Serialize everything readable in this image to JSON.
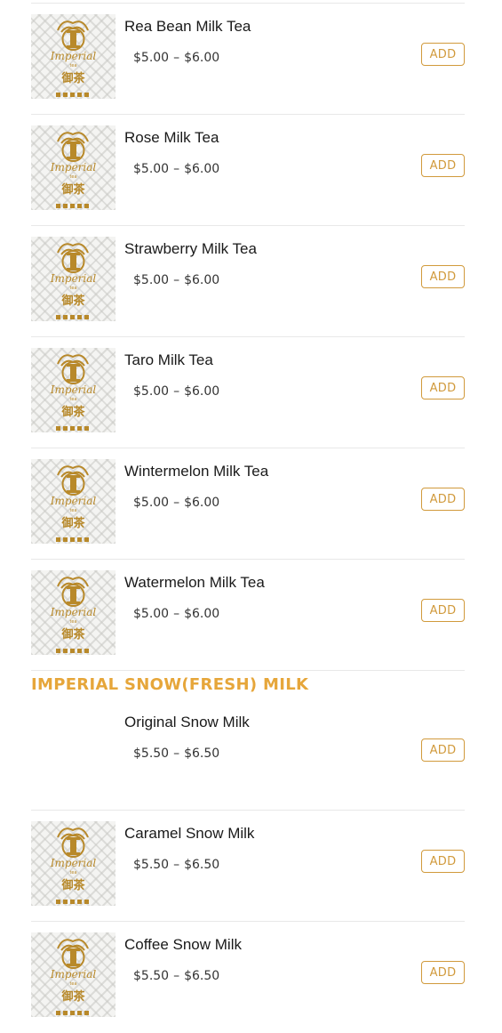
{
  "logo_text": {
    "brand": "Imperial",
    "sub": "tea",
    "cn": "御茶"
  },
  "button_label": "ADD",
  "section": {
    "title": "IMPERIAL SNOW(FRESH) MILK"
  },
  "products": [
    {
      "name": "Rea Bean Milk Tea",
      "price_low": "$5.00",
      "dash": "–",
      "price_high": "$6.00",
      "has_image": true
    },
    {
      "name": "Rose Milk Tea",
      "price_low": "$5.00",
      "dash": "–",
      "price_high": "$6.00",
      "has_image": true
    },
    {
      "name": "Strawberry Milk Tea",
      "price_low": "$5.00",
      "dash": "–",
      "price_high": "$6.00",
      "has_image": true
    },
    {
      "name": "Taro Milk Tea",
      "price_low": "$5.00",
      "dash": "–",
      "price_high": "$6.00",
      "has_image": true
    },
    {
      "name": "Wintermelon Milk Tea",
      "price_low": "$5.00",
      "dash": "–",
      "price_high": "$6.00",
      "has_image": true
    },
    {
      "name": "Watermelon Milk Tea",
      "price_low": "$5.00",
      "dash": "–",
      "price_high": "$6.00",
      "has_image": true
    },
    {
      "name": "Original Snow Milk",
      "price_low": "$5.50",
      "dash": "–",
      "price_high": "$6.50",
      "has_image": false
    },
    {
      "name": "Caramel Snow Milk",
      "price_low": "$5.50",
      "dash": "–",
      "price_high": "$6.50",
      "has_image": true
    },
    {
      "name": "Coffee Snow Milk",
      "price_low": "$5.50",
      "dash": "–",
      "price_high": "$6.50",
      "has_image": true
    }
  ],
  "colors": {
    "accent": "#d19a3c",
    "section_title": "#e6a63a",
    "logo_gold": "#b8892a"
  }
}
